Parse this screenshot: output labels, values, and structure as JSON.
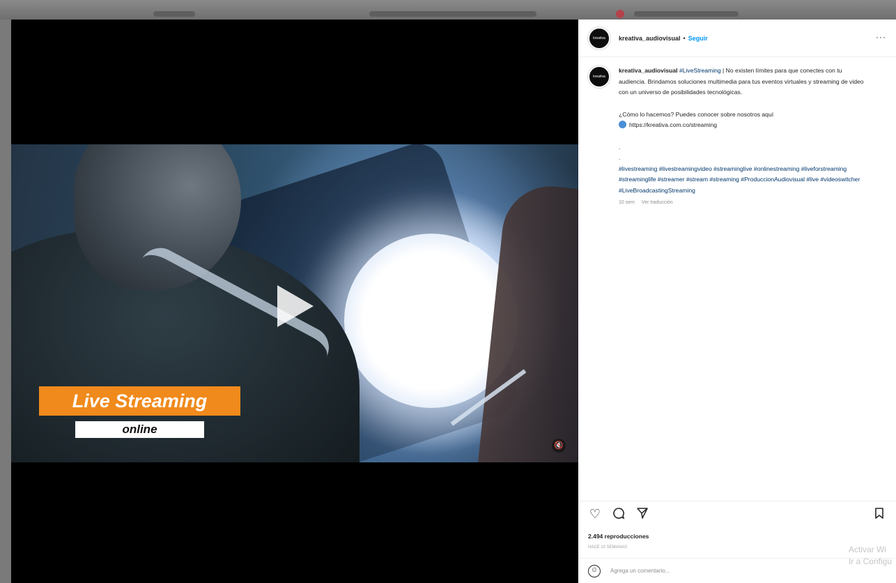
{
  "post": {
    "username": "kreativa_audiovisual",
    "separator": "•",
    "follow_label": "Seguir",
    "more_label": "···",
    "avatar_label": "kreativa"
  },
  "overlay": {
    "title": "Live Streaming",
    "subtitle": "online"
  },
  "caption": {
    "username": "kreativa_audiovisual",
    "first_tag": "#LiveStreaming",
    "paragraph1": " | No existen límites para que conectes con tu audiencia. Brindamos soluciones multimedia para tus eventos virtuales y streaming de video con un universo de posibilidades tecnológicas.",
    "paragraph2": "¿Cómo lo hacemos? Puedes conocer sobre nosotros aquí",
    "link": "https://kreativa.com.co/streaming",
    "dot1": ".",
    "dot2": ".",
    "hashtags": "#livestreaming #livestreamingvideo #streaminglive #onlinestreaming #liveforstreaming #streaminglife #streamer #stream #streaming #ProduccionAudiovisual #live #videoswitcher #LiveBroadcastingStreaming",
    "time_ago": "10 sem",
    "see_translation": "Ver traducción"
  },
  "stats": {
    "views": "2.494 reproducciones",
    "posted_ago": "HACE 10 SEMANAS"
  },
  "comment": {
    "placeholder": "Agrega un comentario..."
  },
  "watermark": {
    "line1": "Activar Wi",
    "line2": "Ir a Configu"
  },
  "icons": {
    "like": "heart-icon",
    "comment": "comment-icon",
    "share": "share-icon",
    "save": "bookmark-icon",
    "emoji": "emoji-icon",
    "play": "play-icon",
    "mute": "speaker-muted-icon"
  },
  "colors": {
    "accent_blue": "#0095f6",
    "hashtag_blue": "#00376b",
    "overlay_orange": "#f08a1c"
  }
}
